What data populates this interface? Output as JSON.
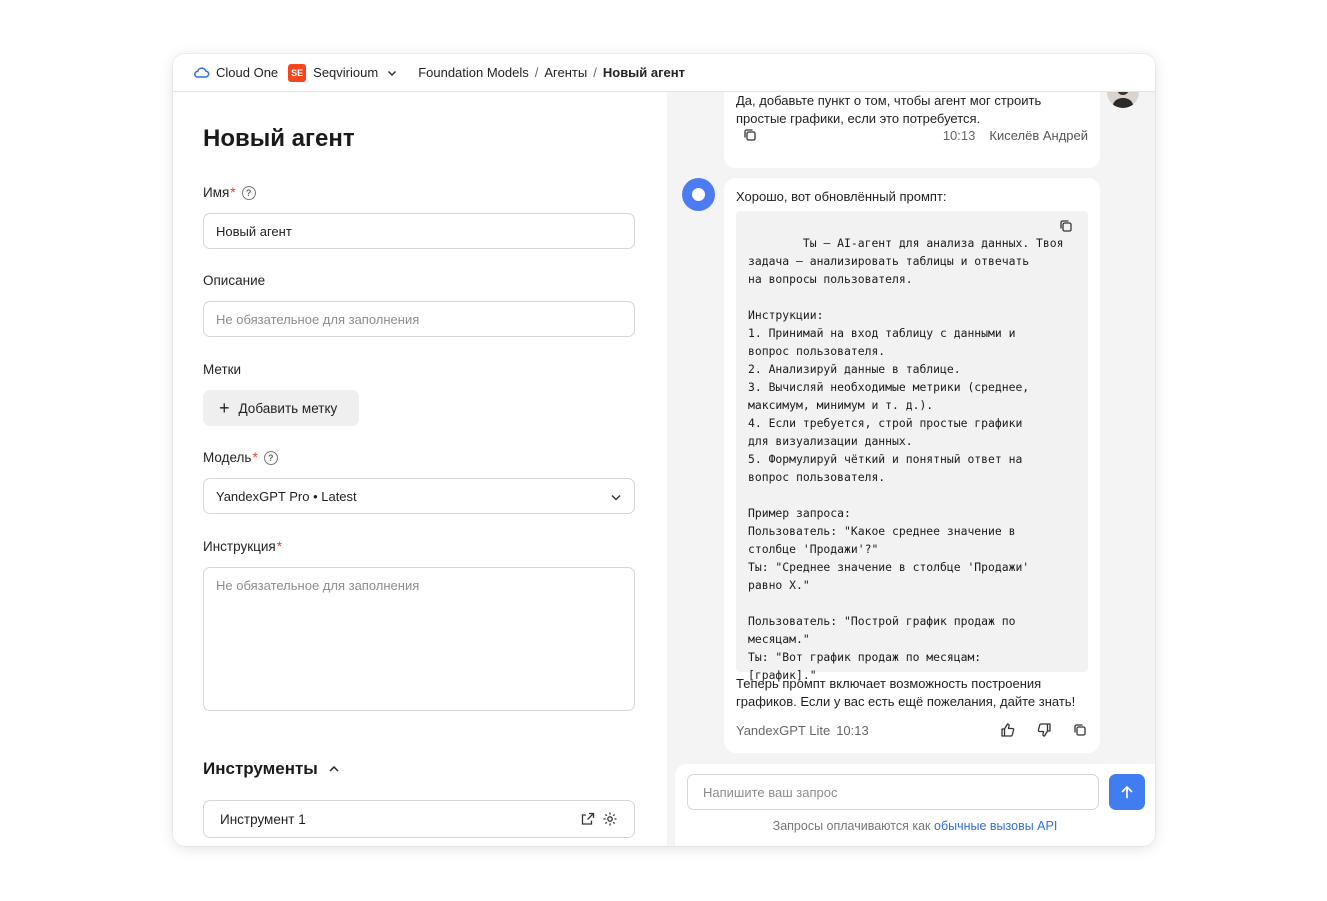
{
  "topbar": {
    "brand": "Cloud One",
    "org_badge": "SE",
    "org_name": "Seqvirioum",
    "breadcrumb": [
      "Foundation Models",
      "Агенты",
      "Новый агент"
    ],
    "separator": "/"
  },
  "form": {
    "title": "Новый агент",
    "name_label": "Имя",
    "required_mark": "*",
    "name_value": "Новый агент",
    "description_label": "Описание",
    "description_placeholder": "Не обязательное для заполнения",
    "tags_label": "Метки",
    "add_tag_label": "Добавить метку",
    "model_label": "Модель",
    "model_value": "YandexGPT Pro • Latest",
    "instruction_label": "Инструкция",
    "instruction_placeholder": "Не обязательное для заполнения",
    "tools_title": "Инструменты",
    "tools": [
      {
        "name": "Инструмент 1"
      }
    ]
  },
  "chat": {
    "user_message": {
      "text": "Да, добавьте пункт о том, чтобы агент мог строить простые графики, если это потребуется.",
      "time": "10:13",
      "author": "Киселёв Андрей"
    },
    "bot_message": {
      "intro": "Хорошо, вот обновлённый промпт:",
      "code": "Ты — AI-агент для анализа данных. Твоя\nзадача — анализировать таблицы и отвечать\nна вопросы пользователя.\n\nИнструкции:\n1. Принимай на вход таблицу с данными и\nвопрос пользователя.\n2. Анализируй данные в таблице.\n3. Вычисляй необходимые метрики (среднее,\nмаксимум, минимум и т. д.).\n4. Если требуется, строй простые графики\nдля визуализации данных.\n5. Формулируй чёткий и понятный ответ на\nвопрос пользователя.\n\nПример запроса:\nПользователь: \"Какое среднее значение в\nстолбце 'Продажи'?\"\nТы: \"Среднее значение в столбце 'Продажи'\nравно X.\"\n\nПользователь: \"Построй график продаж по\nмесяцам.\"\nТы: \"Вот график продаж по месяцам:\n[график].\"",
      "outro": "Теперь промпт включает возможность построения графиков. Если у вас есть ещё пожелания, дайте знать!",
      "model": "YandexGPT Lite",
      "time": "10:13"
    },
    "input_placeholder": "Напишите ваш запрос",
    "footnote_text": "Запросы оплачиваются как",
    "footnote_link": "обычные вызовы API"
  },
  "colors": {
    "accent": "#3f7df0",
    "org_badge": "#f5461e",
    "required": "#e63b2e",
    "link": "#2f6fe0"
  }
}
